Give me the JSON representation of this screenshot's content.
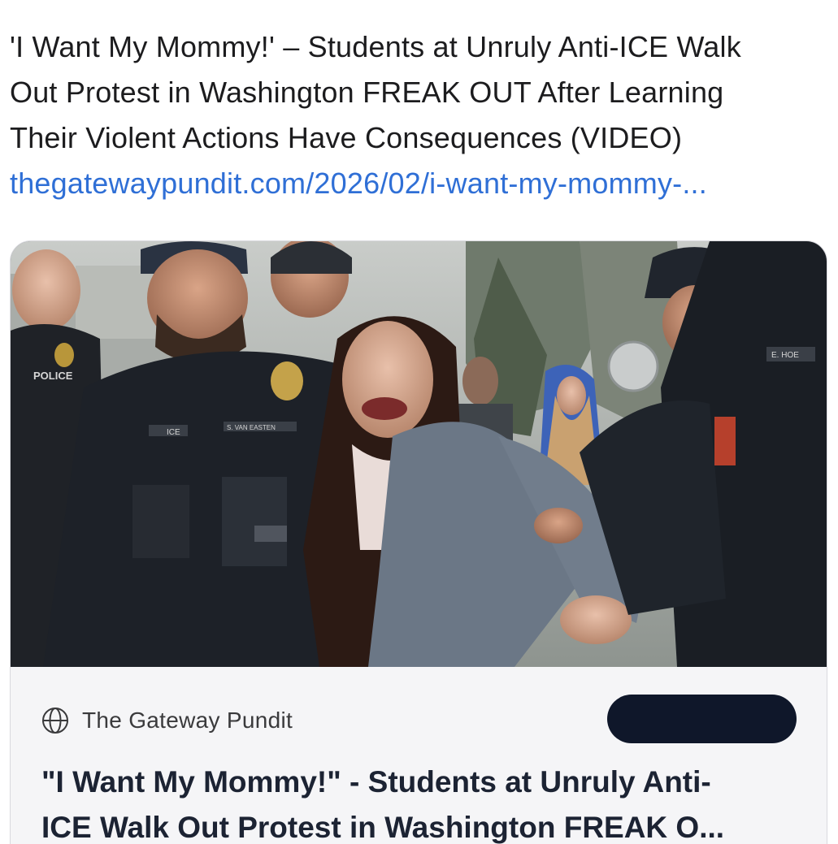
{
  "post": {
    "text_line1": "'I Want My Mommy!' – Students at Unruly Anti-ICE Walk",
    "text_line2": "Out Protest in Washington FREAK OUT After Learning",
    "text_line3": "Their Violent Actions Have Consequences (VIDEO)",
    "link": "thegatewaypundit.com/2026/02/i-want-my-mommy-..."
  },
  "card": {
    "source_icon": "globe-icon",
    "source_name": "The Gateway Pundit",
    "headline_line1": "\"I Want My Mommy!\" - Students at Unruly Anti-",
    "headline_line2": "ICE Walk Out Protest in Washington FREAK O...",
    "image_patches": [
      "POLICE",
      "ICE",
      "S. VAN EASTEN",
      "E. HOE"
    ]
  },
  "colors": {
    "link": "#2f6fd6",
    "text": "#1c1c1e",
    "headline": "#1c2333",
    "pill": "#0f172a",
    "card_bg": "#f5f5f7"
  }
}
